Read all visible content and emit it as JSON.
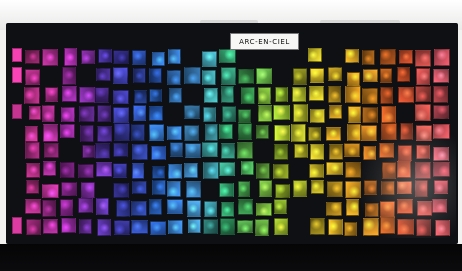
{
  "sign": {
    "text": "ARC-EN-CIEL"
  },
  "colors": {
    "wall": "#f2f2f1",
    "board": "#0f1013",
    "floor": "#050506",
    "spectrum": [
      "#d2389a",
      "#a52fb0",
      "#4a3fc0",
      "#2f6fe0",
      "#4ea7ea",
      "#37b96b",
      "#a6d232",
      "#f2d22c",
      "#f4a024",
      "#e85a2c",
      "#ef5d6f"
    ]
  }
}
